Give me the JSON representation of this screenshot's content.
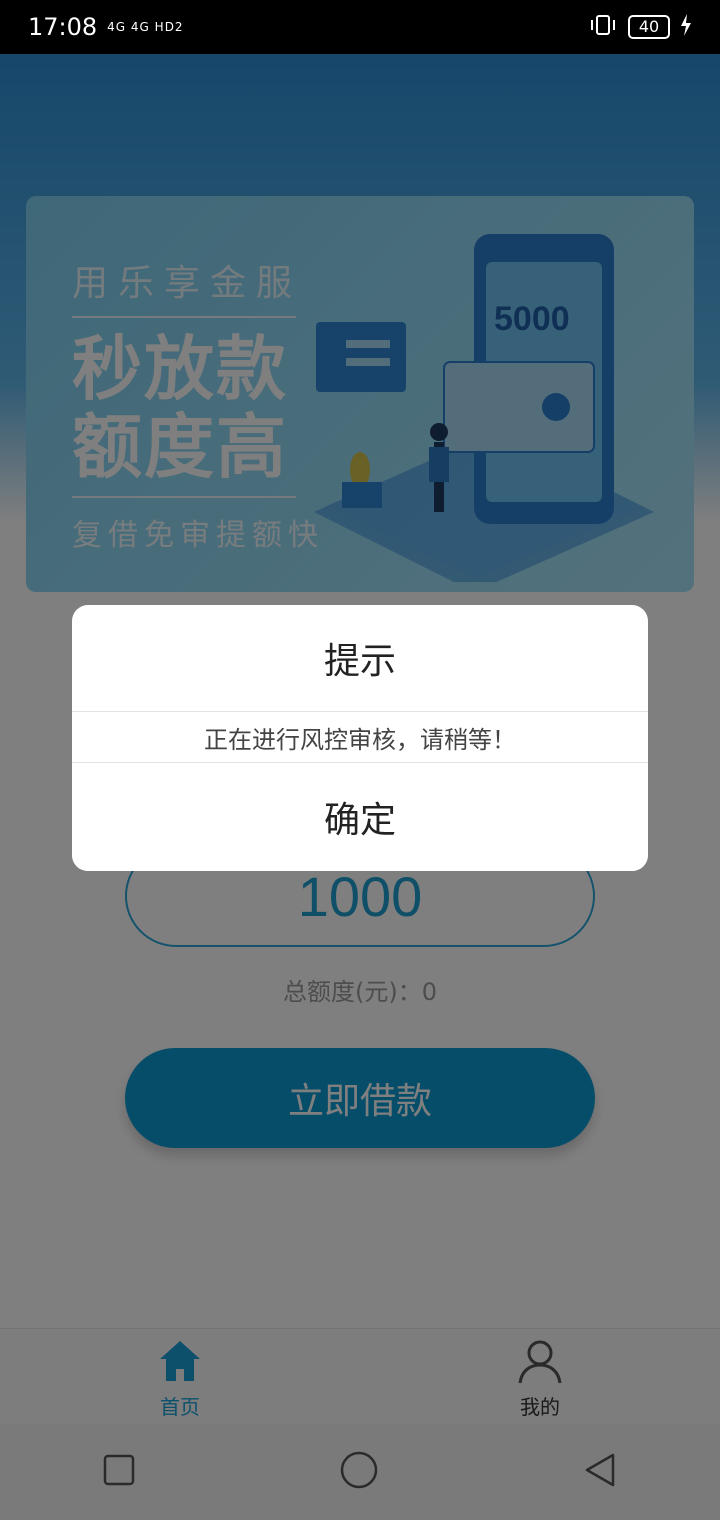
{
  "status_bar": {
    "time": "17:08",
    "network": "4G 4G HD2",
    "battery": "40"
  },
  "banner": {
    "subtitle": "用乐享金服",
    "headline_line1": "秒放款",
    "headline_line2": "额度高",
    "footer": "复借免审提额快",
    "phone_amount": "5000"
  },
  "loan": {
    "amount": "1000",
    "total_label": "总额度(元)：0",
    "borrow_button": "立即借款"
  },
  "tabs": [
    {
      "label": "首页",
      "icon": "home-icon",
      "active": true
    },
    {
      "label": "我的",
      "icon": "user-icon",
      "active": false
    }
  ],
  "dialog": {
    "title": "提示",
    "message": "正在进行风控审核，请稍等！",
    "confirm": "确定"
  },
  "colors": {
    "accent": "#1aa0d8",
    "button": "#0a9bd3",
    "overlay": "rgba(0,0,0,0.5)"
  }
}
